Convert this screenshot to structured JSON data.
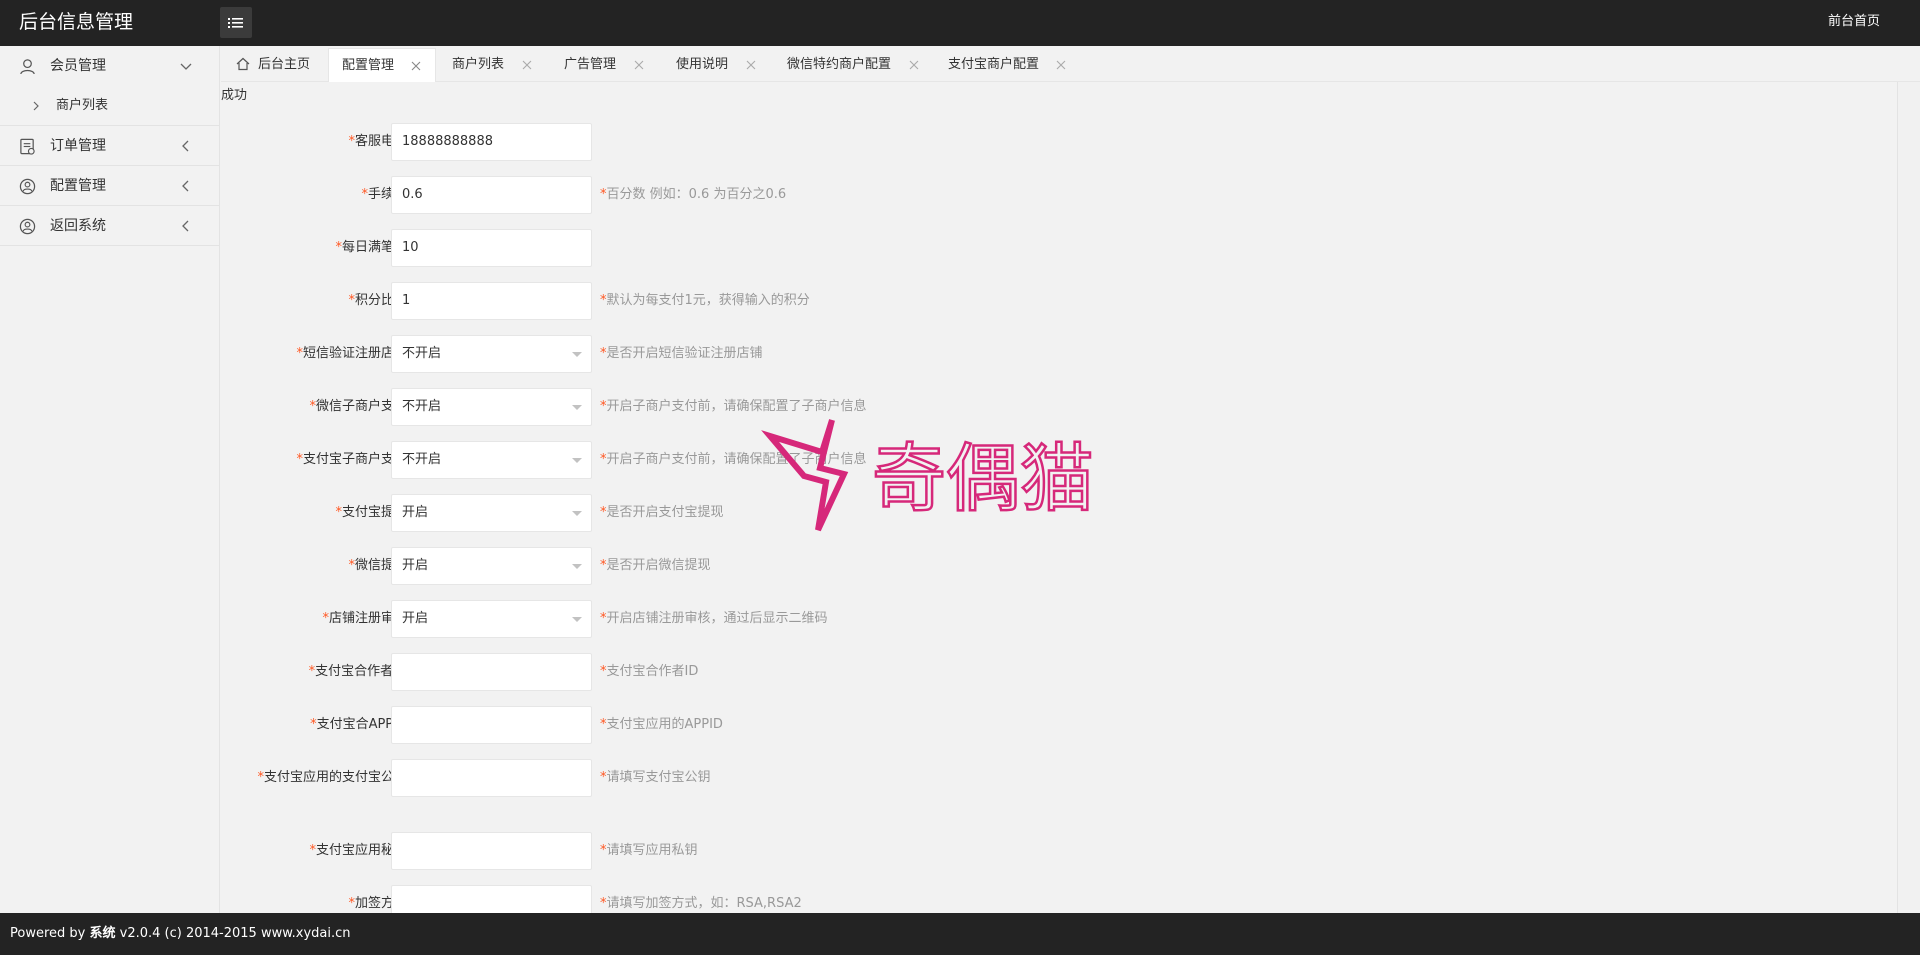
{
  "header": {
    "brand": "后台信息管理",
    "menu_toggle_icon": "list-icon",
    "front_link": "前台首页"
  },
  "sidebar": {
    "items": [
      {
        "label": "会员管理",
        "icon": "user-icon",
        "state": "expanded"
      },
      {
        "label": "商户列表",
        "icon": "chevron-right-icon",
        "state": "sub"
      },
      {
        "label": "订单管理",
        "icon": "order-icon",
        "state": "collapsed"
      },
      {
        "label": "配置管理",
        "icon": "settings-icon",
        "state": "collapsed"
      },
      {
        "label": "返回系统",
        "icon": "return-icon",
        "state": "collapsed"
      }
    ]
  },
  "tabs": [
    {
      "label": "后台主页",
      "closable": false,
      "icon": "home-icon"
    },
    {
      "label": "配置管理",
      "closable": true,
      "active": true
    },
    {
      "label": "商户列表",
      "closable": true
    },
    {
      "label": "广告管理",
      "closable": true
    },
    {
      "label": "使用说明",
      "closable": true
    },
    {
      "label": "微信特约商户配置",
      "closable": true
    },
    {
      "label": "支付宝商户配置",
      "closable": true
    }
  ],
  "content": {
    "status": "成功",
    "required_mark": "*",
    "fields": [
      {
        "label": "客服电话",
        "type": "input",
        "value": "18888888888",
        "tip": ""
      },
      {
        "label": "手续费",
        "type": "input",
        "value": "0.6",
        "tip": "百分数 例如：0.6 为百分之0.6"
      },
      {
        "label": "每日满笔数",
        "type": "input",
        "value": "10",
        "tip": ""
      },
      {
        "label": "积分比列",
        "type": "input",
        "value": "1",
        "tip": "默认为每支付1元，获得输入的积分"
      },
      {
        "label": "短信验证注册店铺",
        "type": "select",
        "value": "不开启",
        "tip": "是否开启短信验证注册店铺"
      },
      {
        "label": "微信子商户支付",
        "type": "select",
        "value": "不开启",
        "tip": "开启子商户支付前，请确保配置了子商户信息"
      },
      {
        "label": "支付宝子商户支付",
        "type": "select",
        "value": "不开启",
        "tip": "开启子商户支付前，请确保配置了子商户信息"
      },
      {
        "label": "支付宝提现",
        "type": "select",
        "value": "开启",
        "tip": "是否开启支付宝提现"
      },
      {
        "label": "微信提现",
        "type": "select",
        "value": "开启",
        "tip": "是否开启微信提现"
      },
      {
        "label": "店铺注册审核",
        "type": "select",
        "value": "开启",
        "tip": "开启店铺注册审核，通过后显示二维码"
      },
      {
        "label": "支付宝合作者ID",
        "type": "input",
        "value": "",
        "tip": "支付宝合作者ID"
      },
      {
        "label": "支付宝合APPID",
        "type": "input",
        "value": "",
        "tip": "支付宝应用的APPID"
      },
      {
        "label": "支付宝应用的支付宝公钥",
        "type": "input",
        "value": "",
        "tip": "请填写支付宝公钥"
      },
      {
        "label": "支付宝应用秘钥",
        "type": "input",
        "value": "",
        "tip": "请填写应用私钥"
      },
      {
        "label": "加签方式",
        "type": "input",
        "value": "",
        "tip": "请填写加签方式，如：RSA,RSA2"
      }
    ]
  },
  "watermark": {
    "text": "奇偶猫",
    "icon": "lightning-logo-icon",
    "color": "#d6287a"
  },
  "footer": {
    "prefix": "Powered by ",
    "system": "系统",
    "suffix": " v2.0.4 (c) 2014-2015 www.xydai.cn"
  },
  "colors": {
    "header_bg": "#232323",
    "required": "#ff5722",
    "page_bg": "#f2f2f2"
  }
}
